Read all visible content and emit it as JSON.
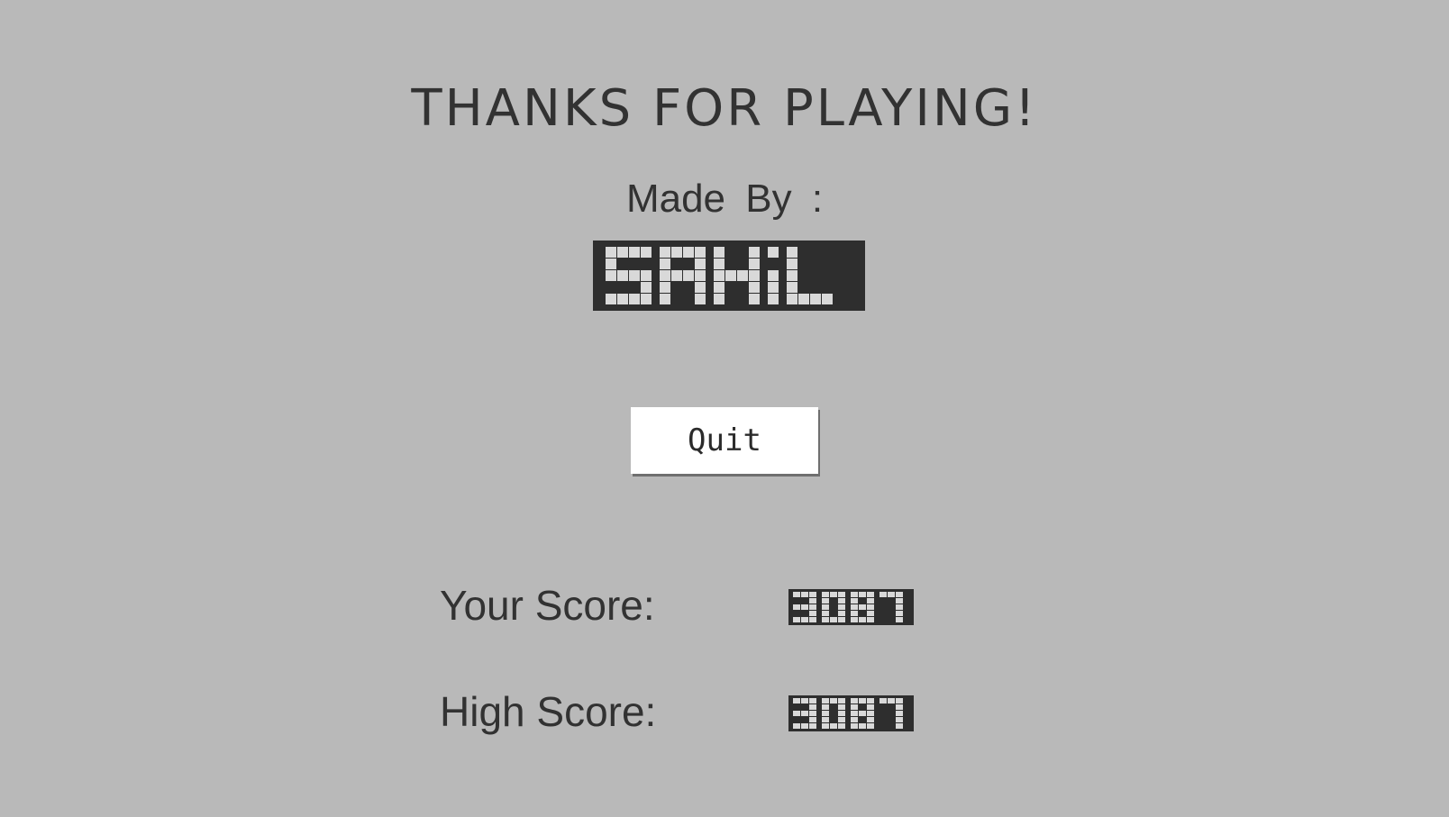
{
  "screen": {
    "title": "THANKS FOR PLAYING!",
    "made_by_label": "Made By :",
    "author_logo_text": "SAHiL",
    "quit_label": "Quit",
    "your_score_label": "Your Score:",
    "your_score_value": "3087",
    "high_score_label": "High Score:",
    "high_score_value": "3087"
  },
  "colors": {
    "background": "#b9b9b9",
    "text": "#323232",
    "pixel_block": "#2e2e2e",
    "pixel_light": "#d9d9d9",
    "button_bg": "#ffffff"
  }
}
